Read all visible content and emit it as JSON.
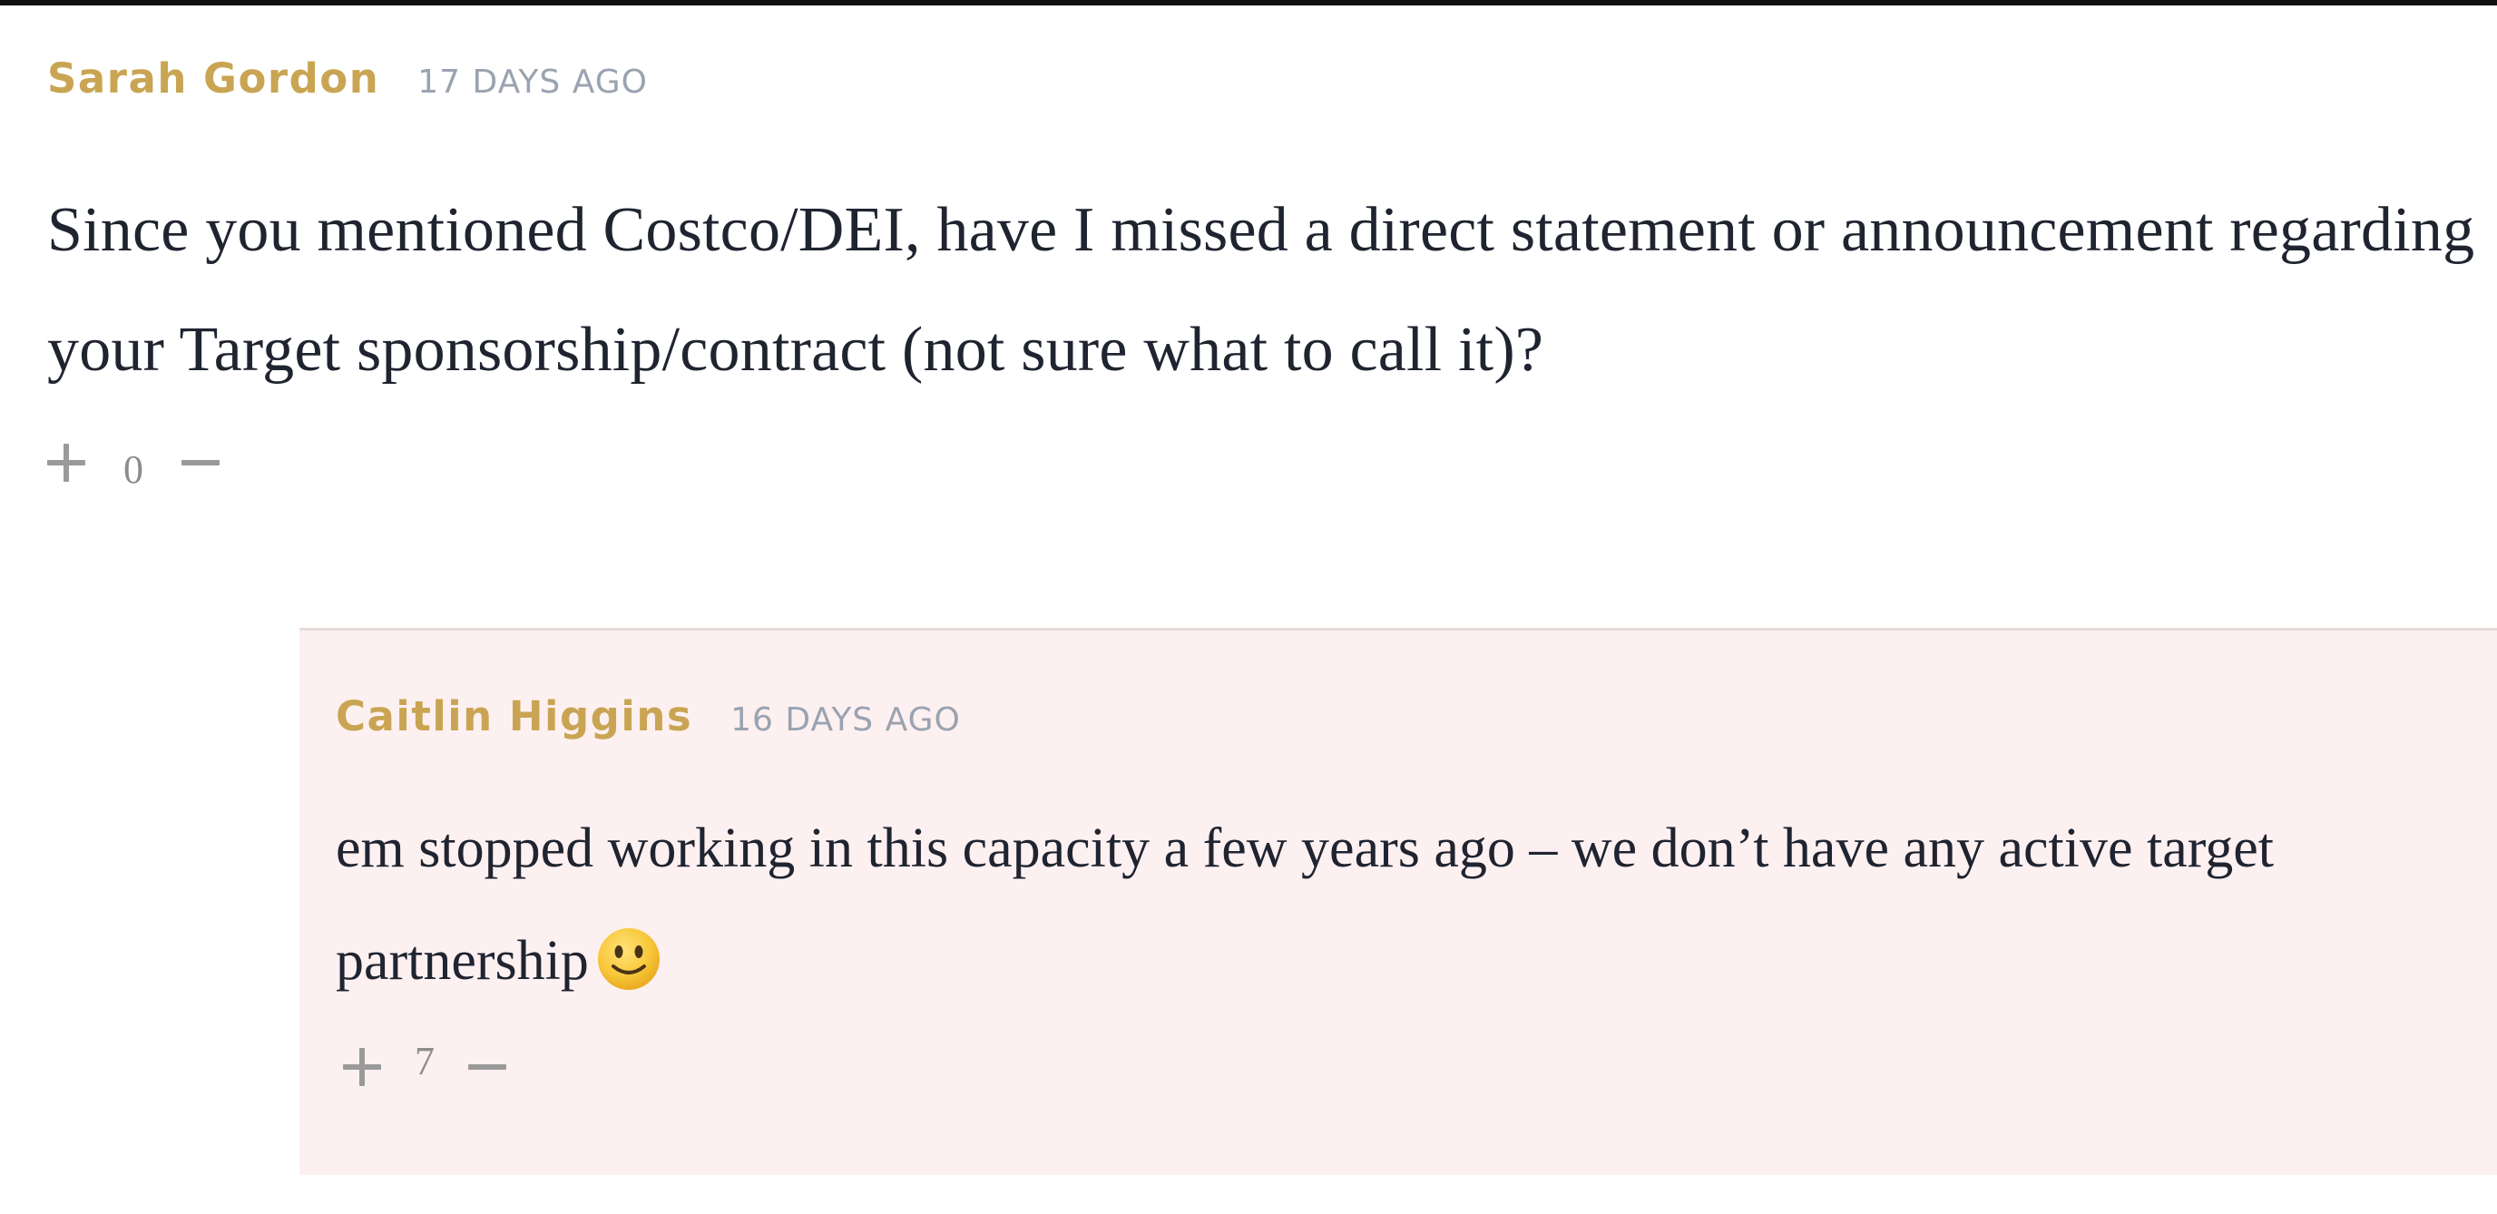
{
  "colors": {
    "author": "#c9a553",
    "timestamp": "#9aa3b0",
    "body_text": "#1f2430",
    "vote_icon": "#9a9a9a",
    "score": "#8c8c8c",
    "reply_background": "#fdf0f1",
    "emoji_face": "#f7c236"
  },
  "comments": [
    {
      "author": "Sarah Gordon",
      "timestamp": "17 DAYS AGO",
      "body": "Since you mentioned Costco/DEI, have I missed a direct statement or announcement regarding your Target sponsorship/contract (not sure what to call it)?",
      "score": "0",
      "upvote_icon": "plus-icon",
      "downvote_icon": "minus-icon"
    }
  ],
  "reply": {
    "author": "Caitlin Higgins",
    "timestamp": "16 DAYS AGO",
    "body": "em stopped working in this capacity a few years ago – we don’t have any active target partnership",
    "emoji": "slightly-smiling-face-icon",
    "score": "7",
    "upvote_icon": "plus-icon",
    "downvote_icon": "minus-icon"
  }
}
